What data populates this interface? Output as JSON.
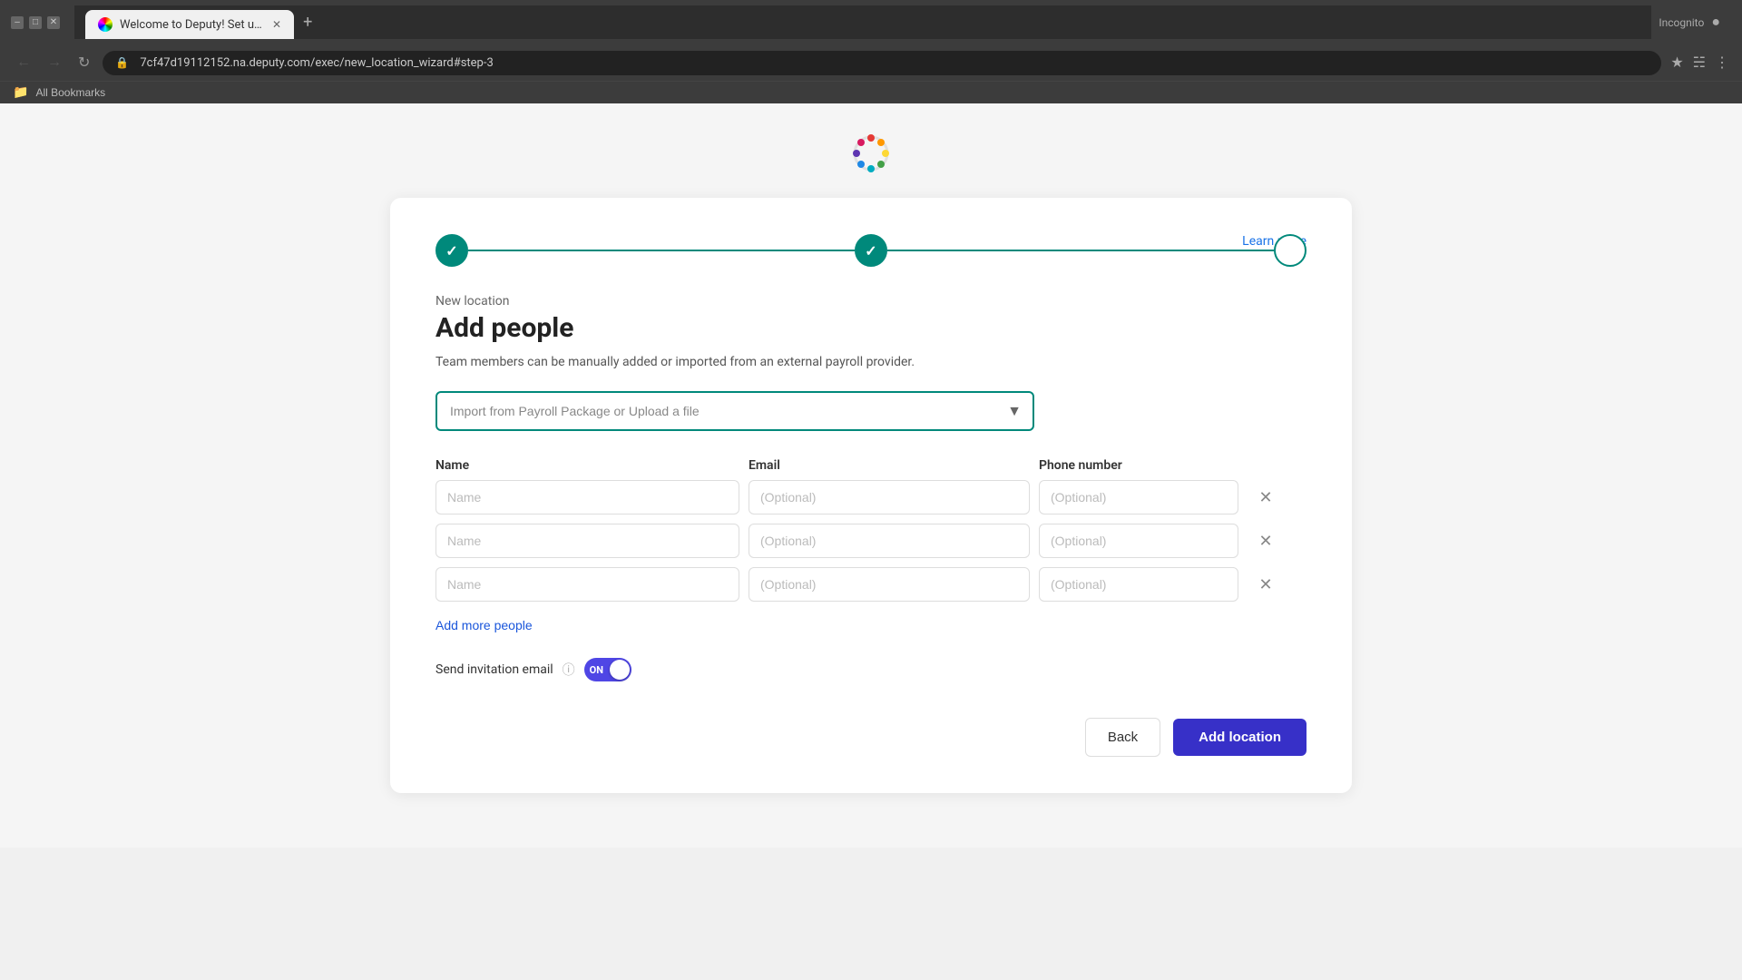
{
  "browser": {
    "tab_title": "Welcome to Deputy! Set up yo",
    "url": "7cf47d19112152.na.deputy.com/exec/new_location_wizard#step-3",
    "new_tab_label": "+",
    "bookmarks_label": "All Bookmarks",
    "back_disabled": true,
    "forward_disabled": true
  },
  "stepper": {
    "steps": [
      {
        "id": 1,
        "state": "completed"
      },
      {
        "id": 2,
        "state": "completed"
      },
      {
        "id": 3,
        "state": "active"
      }
    ]
  },
  "learn_more": "Learn more",
  "section_label": "New location",
  "page_title": "Add people",
  "description": "Team members can be manually added or imported from an external payroll provider.",
  "import_dropdown": {
    "value": "Import from Payroll Package or Upload a file",
    "placeholder": "Import from Payroll Package or Upload a file"
  },
  "fields_header": {
    "name": "Name",
    "email": "Email",
    "phone": "Phone number"
  },
  "people_rows": [
    {
      "name_placeholder": "Name",
      "email_placeholder": "(Optional)",
      "phone_placeholder": "(Optional)"
    },
    {
      "name_placeholder": "Name",
      "email_placeholder": "(Optional)",
      "phone_placeholder": "(Optional)"
    },
    {
      "name_placeholder": "Name",
      "email_placeholder": "(Optional)",
      "phone_placeholder": "(Optional)"
    }
  ],
  "add_more_label": "Add more people",
  "invitation": {
    "label": "Send invitation email",
    "toggle_label": "ON",
    "toggle_state": true
  },
  "footer": {
    "back_label": "Back",
    "add_location_label": "Add location"
  }
}
